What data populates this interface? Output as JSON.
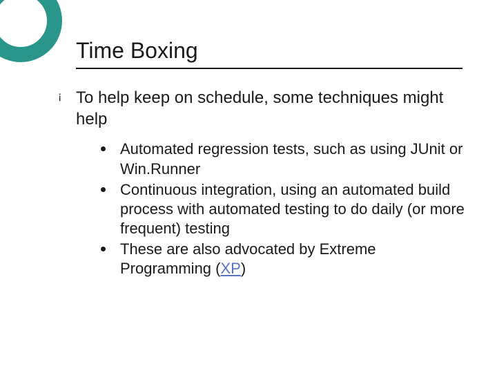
{
  "slide": {
    "title": "Time Boxing",
    "main_point": "To help keep on schedule, some techniques might help",
    "sub_points": [
      "Automated regression tests, such as using JUnit or Win.Runner",
      "Continuous integration, using an automated build process with automated testing to do daily (or more frequent) testing",
      "These are also advocated by Extreme Programming ("
    ],
    "link_text": "XP",
    "after_link": ")"
  }
}
